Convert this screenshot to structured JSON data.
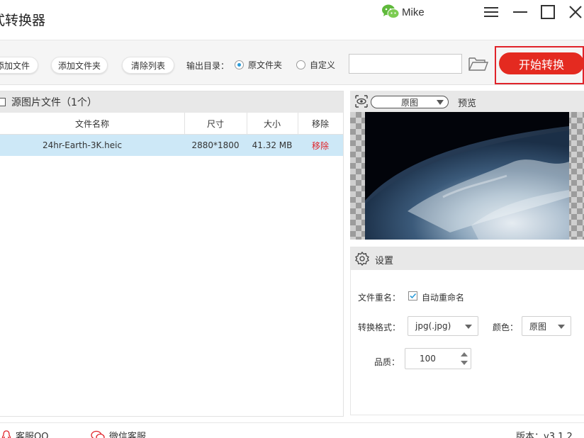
{
  "app": {
    "title": "式转换器",
    "user_name": "Mike"
  },
  "toolbar": {
    "add_file_label": "添加文件",
    "add_folder_label": "添加文件夹",
    "clear_list_label": "清除列表",
    "output_dir_label": "输出目录：",
    "radio_original_label": "原文件夹",
    "radio_custom_label": "自定义",
    "selected_output": "原文件夹",
    "path_value": "",
    "start_label": "开始转换"
  },
  "file_list": {
    "header": "源图片文件（1个）",
    "columns": {
      "name": "文件名称",
      "size": "尺寸",
      "filesize": "大小",
      "remove": "移除"
    },
    "rows": [
      {
        "name": "24hr-Earth-3K.heic",
        "dimensions": "2880*1800",
        "filesize": "41.32 MB",
        "remove": "移除"
      }
    ]
  },
  "preview": {
    "view_mode": "原图",
    "label": "预览"
  },
  "settings": {
    "title": "设置",
    "rename_label": "文件重名：",
    "auto_rename_label": "自动重命名",
    "auto_rename_checked": true,
    "format_label": "转换格式：",
    "format_value": "jpg(.jpg)",
    "color_label": "颜色：",
    "color_value": "原图",
    "quality_label": "品质：",
    "quality_value": "100"
  },
  "footer": {
    "qq_support": "客服QQ",
    "wechat_support": "微信客服",
    "version": "版本：v3.1.2"
  },
  "colors": {
    "accent_red": "#e42a20",
    "radio_blue": "#2b9bd8",
    "selected_row": "#cde8f7",
    "panel_header": "#e8e8e8"
  }
}
